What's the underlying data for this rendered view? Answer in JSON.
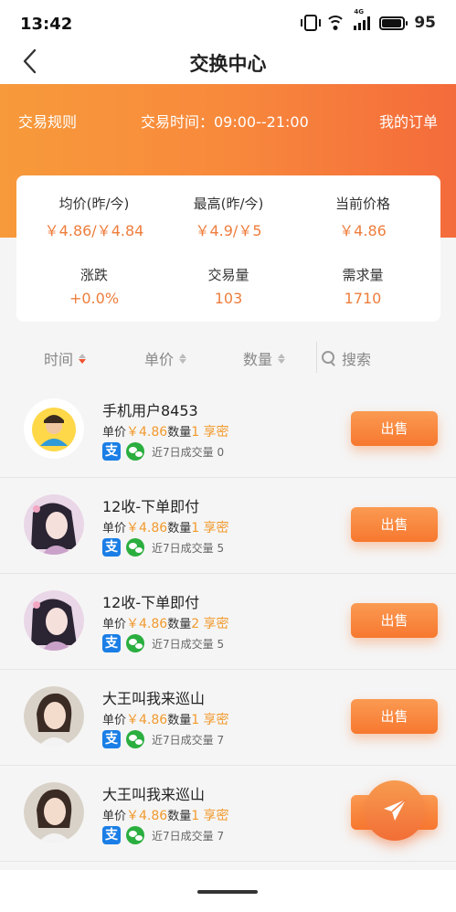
{
  "status": {
    "time": "13:42",
    "signal": "4G",
    "battery": "95",
    "battery_level": 0.95
  },
  "nav": {
    "title": "交换中心",
    "back_icon": "chevron-left-icon"
  },
  "band": {
    "rules": "交易规则",
    "time_info": "交易时间：09:00--21:00",
    "orders": "我的订单"
  },
  "stats": [
    {
      "label": "均价(昨/今)",
      "value": "￥4.86/￥4.84"
    },
    {
      "label": "最高(昨/今)",
      "value": "￥4.9/￥5"
    },
    {
      "label": "当前价格",
      "value": "￥4.86"
    },
    {
      "label": "涨跌",
      "value": "+0.0%"
    },
    {
      "label": "交易量",
      "value": "103"
    },
    {
      "label": "需求量",
      "value": "1710"
    }
  ],
  "filters": {
    "time": "时间",
    "price": "单价",
    "qty": "数量",
    "search": "搜索"
  },
  "list": [
    {
      "name": "手机用户8453",
      "unit": "单价",
      "price": "￥4.86",
      "qty_label": "数量",
      "qty": "1 享密",
      "recent": "近7日成交量",
      "count": "0",
      "button": "出售"
    },
    {
      "name": "12收-下单即付",
      "unit": "单价",
      "price": "￥4.86",
      "qty_label": "数量",
      "qty": "1 享密",
      "recent": "近7日成交量",
      "count": "5",
      "button": "出售"
    },
    {
      "name": "12收-下单即付",
      "unit": "单价",
      "price": "￥4.86",
      "qty_label": "数量",
      "qty": "2 享密",
      "recent": "近7日成交量",
      "count": "5",
      "button": "出售"
    },
    {
      "name": "大王叫我来巡山",
      "unit": "单价",
      "price": "￥4.86",
      "qty_label": "数量",
      "qty": "1 享密",
      "recent": "近7日成交量",
      "count": "7",
      "button": "出售"
    },
    {
      "name": "大王叫我来巡山",
      "unit": "单价",
      "price": "￥4.86",
      "qty_label": "数量",
      "qty": "1 享密",
      "recent": "近7日成交量",
      "count": "7",
      "button": "出售"
    }
  ],
  "pay_icons": {
    "alipay": "支",
    "wechat": "wechat-icon"
  },
  "colors": {
    "accent": "#f7782f",
    "price": "#f29a2e",
    "stat_value": "#ee7d3c"
  },
  "fab": {
    "icon": "paper-plane-icon"
  }
}
